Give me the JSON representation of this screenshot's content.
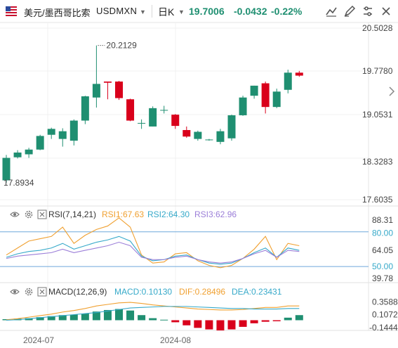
{
  "header": {
    "pair_name": "美元/墨西哥比索",
    "symbol": "USDMXN",
    "period": "日K",
    "last_price": "19.7006",
    "change": "-0.0432",
    "change_pct": "-0.22%"
  },
  "colors": {
    "up": "#d9001b",
    "down": "#1f8f71",
    "rsi1": "#f0a030",
    "rsi2": "#36a9c9",
    "rsi3": "#9b7ed8",
    "macd_line": "#36a9c9",
    "signal_line": "#f0a030",
    "ref_line": "#6fa8dc"
  },
  "chart_data": [
    {
      "type": "candlestick",
      "title": "",
      "y_axis_ticks": [
        "20.5028",
        "19.7780",
        "19.0531",
        "18.3283",
        "17.6035"
      ],
      "ylim": [
        17.6035,
        20.5028
      ],
      "x_axis_ticks": [
        "2024-07",
        "2024-08"
      ],
      "annotations": {
        "high_label": "20.2129",
        "low_label": "17.8934"
      },
      "candles": [
        {
          "o": 17.93,
          "h": 18.36,
          "l": 17.89,
          "c": 18.31
        },
        {
          "o": 18.32,
          "h": 18.44,
          "l": 18.3,
          "c": 18.4
        },
        {
          "o": 18.37,
          "h": 18.48,
          "l": 18.31,
          "c": 18.45
        },
        {
          "o": 18.45,
          "h": 18.7,
          "l": 18.44,
          "c": 18.68
        },
        {
          "o": 18.7,
          "h": 18.82,
          "l": 18.63,
          "c": 18.8
        },
        {
          "o": 18.63,
          "h": 18.81,
          "l": 18.5,
          "c": 18.76
        },
        {
          "o": 18.6,
          "h": 18.96,
          "l": 18.52,
          "c": 18.94
        },
        {
          "o": 18.94,
          "h": 19.36,
          "l": 18.88,
          "c": 19.35
        },
        {
          "o": 19.33,
          "h": 20.21,
          "l": 19.16,
          "c": 19.56
        },
        {
          "o": 19.6,
          "h": 19.6,
          "l": 19.3,
          "c": 19.58
        },
        {
          "o": 19.6,
          "h": 19.61,
          "l": 19.29,
          "c": 19.32
        },
        {
          "o": 19.3,
          "h": 19.31,
          "l": 18.93,
          "c": 18.94
        },
        {
          "o": 18.9,
          "h": 18.96,
          "l": 18.8,
          "c": 18.9
        },
        {
          "o": 18.84,
          "h": 19.18,
          "l": 18.84,
          "c": 19.15
        },
        {
          "o": 19.12,
          "h": 19.19,
          "l": 19.06,
          "c": 19.12
        },
        {
          "o": 19.04,
          "h": 19.05,
          "l": 18.8,
          "c": 18.85
        },
        {
          "o": 18.78,
          "h": 18.84,
          "l": 18.65,
          "c": 18.67
        },
        {
          "o": 18.63,
          "h": 18.77,
          "l": 18.6,
          "c": 18.75
        },
        {
          "o": 18.62,
          "h": 18.63,
          "l": 18.6,
          "c": 18.62
        },
        {
          "o": 18.58,
          "h": 18.8,
          "l": 18.54,
          "c": 18.76
        },
        {
          "o": 18.64,
          "h": 19.04,
          "l": 18.6,
          "c": 19.03
        },
        {
          "o": 19.03,
          "h": 19.36,
          "l": 19.02,
          "c": 19.33
        },
        {
          "o": 19.36,
          "h": 19.53,
          "l": 19.31,
          "c": 19.53
        },
        {
          "o": 19.57,
          "h": 19.6,
          "l": 19.06,
          "c": 19.17
        },
        {
          "o": 19.17,
          "h": 19.48,
          "l": 19.15,
          "c": 19.43
        },
        {
          "o": 19.46,
          "h": 19.8,
          "l": 19.4,
          "c": 19.75
        },
        {
          "o": 19.75,
          "h": 19.78,
          "l": 19.68,
          "c": 19.7
        }
      ]
    },
    {
      "type": "line",
      "title": "RSI(7,14,21)",
      "series": [
        {
          "name": "RSI1:67.63",
          "values": [
            60,
            66,
            72,
            74,
            76,
            84,
            70,
            77,
            82,
            85,
            92,
            84,
            60,
            53,
            54,
            61,
            62,
            55,
            51,
            49,
            51,
            57,
            65,
            76,
            56,
            70,
            68
          ]
        },
        {
          "name": "RSI2:64.30",
          "values": [
            58,
            61,
            63,
            64,
            66,
            70,
            65,
            68,
            71,
            73,
            76,
            72,
            59,
            55,
            56,
            59,
            60,
            56,
            53,
            52,
            53,
            57,
            62,
            66,
            58,
            66,
            64
          ]
        },
        {
          "name": "RSI3:62.96",
          "values": [
            57,
            59,
            60,
            61,
            62,
            65,
            62,
            64,
            66,
            68,
            71,
            68,
            58,
            56,
            56,
            58,
            59,
            56,
            54,
            53,
            54,
            57,
            61,
            64,
            58,
            64,
            63
          ]
        }
      ],
      "y_axis_ticks": [
        "88.31",
        "80.00",
        "64.05",
        "50.00",
        "39.78"
      ],
      "ylim": [
        39.78,
        88.31
      ],
      "reference_lines": [
        80,
        50
      ]
    },
    {
      "type": "bar+line",
      "title": "MACD(12,26,9)",
      "series": [
        {
          "name": "MACD:0.10130",
          "values": [
            0.02,
            0.03,
            0.04,
            0.06,
            0.08,
            0.1,
            0.11,
            0.13,
            0.17,
            0.2,
            0.22,
            0.19,
            0.1,
            0.04,
            0.01,
            -0.04,
            -0.1,
            -0.15,
            -0.18,
            -0.2,
            -0.18,
            -0.13,
            -0.06,
            -0.03,
            -0.02,
            0.05,
            0.1
          ]
        },
        {
          "name": "DIF:0.28496",
          "values": [
            0.01,
            0.03,
            0.06,
            0.09,
            0.12,
            0.16,
            0.19,
            0.23,
            0.28,
            0.31,
            0.34,
            0.35,
            0.33,
            0.3,
            0.28,
            0.26,
            0.24,
            0.22,
            0.21,
            0.2,
            0.2,
            0.21,
            0.23,
            0.25,
            0.25,
            0.28,
            0.28
          ]
        },
        {
          "name": "DEA:0.23431",
          "values": [
            0.0,
            0.01,
            0.03,
            0.05,
            0.07,
            0.09,
            0.11,
            0.13,
            0.15,
            0.18,
            0.21,
            0.24,
            0.25,
            0.26,
            0.27,
            0.27,
            0.27,
            0.26,
            0.25,
            0.24,
            0.23,
            0.23,
            0.22,
            0.22,
            0.22,
            0.23,
            0.23
          ]
        }
      ],
      "y_axis_ticks": [
        "0.35883",
        "0.10722",
        "-0.14440"
      ],
      "ylim": [
        -0.2,
        0.42
      ]
    }
  ]
}
